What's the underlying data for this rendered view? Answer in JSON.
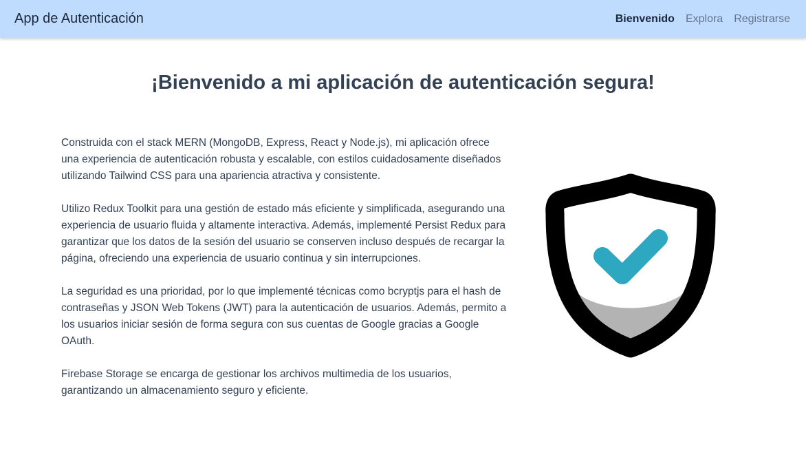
{
  "navbar": {
    "brand": "App de Autenticación",
    "links": [
      {
        "label": "Bienvenido",
        "active": true
      },
      {
        "label": "Explora",
        "active": false
      },
      {
        "label": "Registrarse",
        "active": false
      }
    ]
  },
  "main": {
    "title": "¡Bienvenido a mi aplicación de autenticación segura!",
    "paragraphs": [
      "Construida con el stack MERN (MongoDB, Express, React y Node.js), mi aplicación ofrece una experiencia de autenticación robusta y escalable, con estilos cuidadosamente diseñados utilizando Tailwind CSS para una apariencia atractiva y consistente.",
      "Utilizo Redux Toolkit para una gestión de estado más eficiente y simplificada, asegurando una experiencia de usuario fluida y altamente interactiva. Además, implementé Persist Redux para garantizar que los datos de la sesión del usuario se conserven incluso después de recargar la página, ofreciendo una experiencia de usuario continua y sin interrupciones.",
      "La seguridad es una prioridad, por lo que implementé técnicas como bcryptjs para el hash de contraseñas y JSON Web Tokens (JWT) para la autenticación de usuarios. Además, permito a los usuarios iniciar sesión de forma segura con sus cuentas de Google gracias a Google OAuth.",
      "Firebase Storage se encarga de gestionar los archivos multimedia de los usuarios, garantizando un almacenamiento seguro y eficiente."
    ]
  },
  "illustration": {
    "icon": "shield-check-icon",
    "colors": {
      "outline": "#000000",
      "fill": "#ffffff",
      "shadow": "#b3b3b3",
      "check": "#2ea8c0"
    }
  },
  "colors": {
    "navbar_bg": "#bfdbfe",
    "text": "#334155"
  }
}
